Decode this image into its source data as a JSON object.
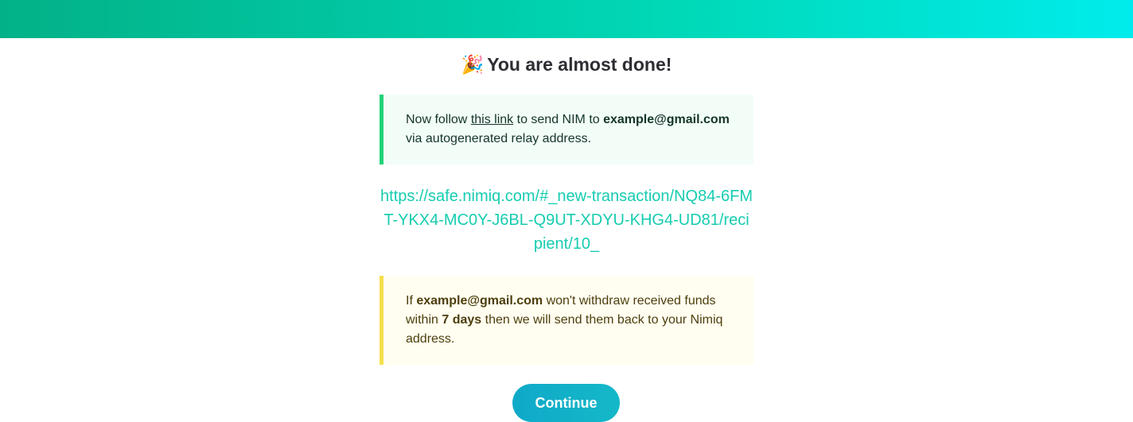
{
  "header": {
    "emoji": "🎉",
    "title": "You are almost done!"
  },
  "instruction": {
    "prefix": "Now follow ",
    "link_text": "this link",
    "middle": " to send NIM to ",
    "email": "example@gmail.com",
    "suffix": " via autogenerated relay address."
  },
  "relay": {
    "url": "https://safe.nimiq.com/#_new-transaction/NQ84-6FMT-YKX4-MC0Y-J6BL-Q9UT-XDYU-KHG4-UD81/recipient/10_"
  },
  "warning": {
    "prefix": "If ",
    "email": "example@gmail.com",
    "middle": " won't withdraw received funds within ",
    "days": "7 days",
    "suffix": " then we will send them back to your Nimiq address."
  },
  "actions": {
    "continue_label": "Continue"
  },
  "colors": {
    "accent": "#16ccb0",
    "success_border": "#22d27a",
    "warning_border": "#f5df4d"
  }
}
